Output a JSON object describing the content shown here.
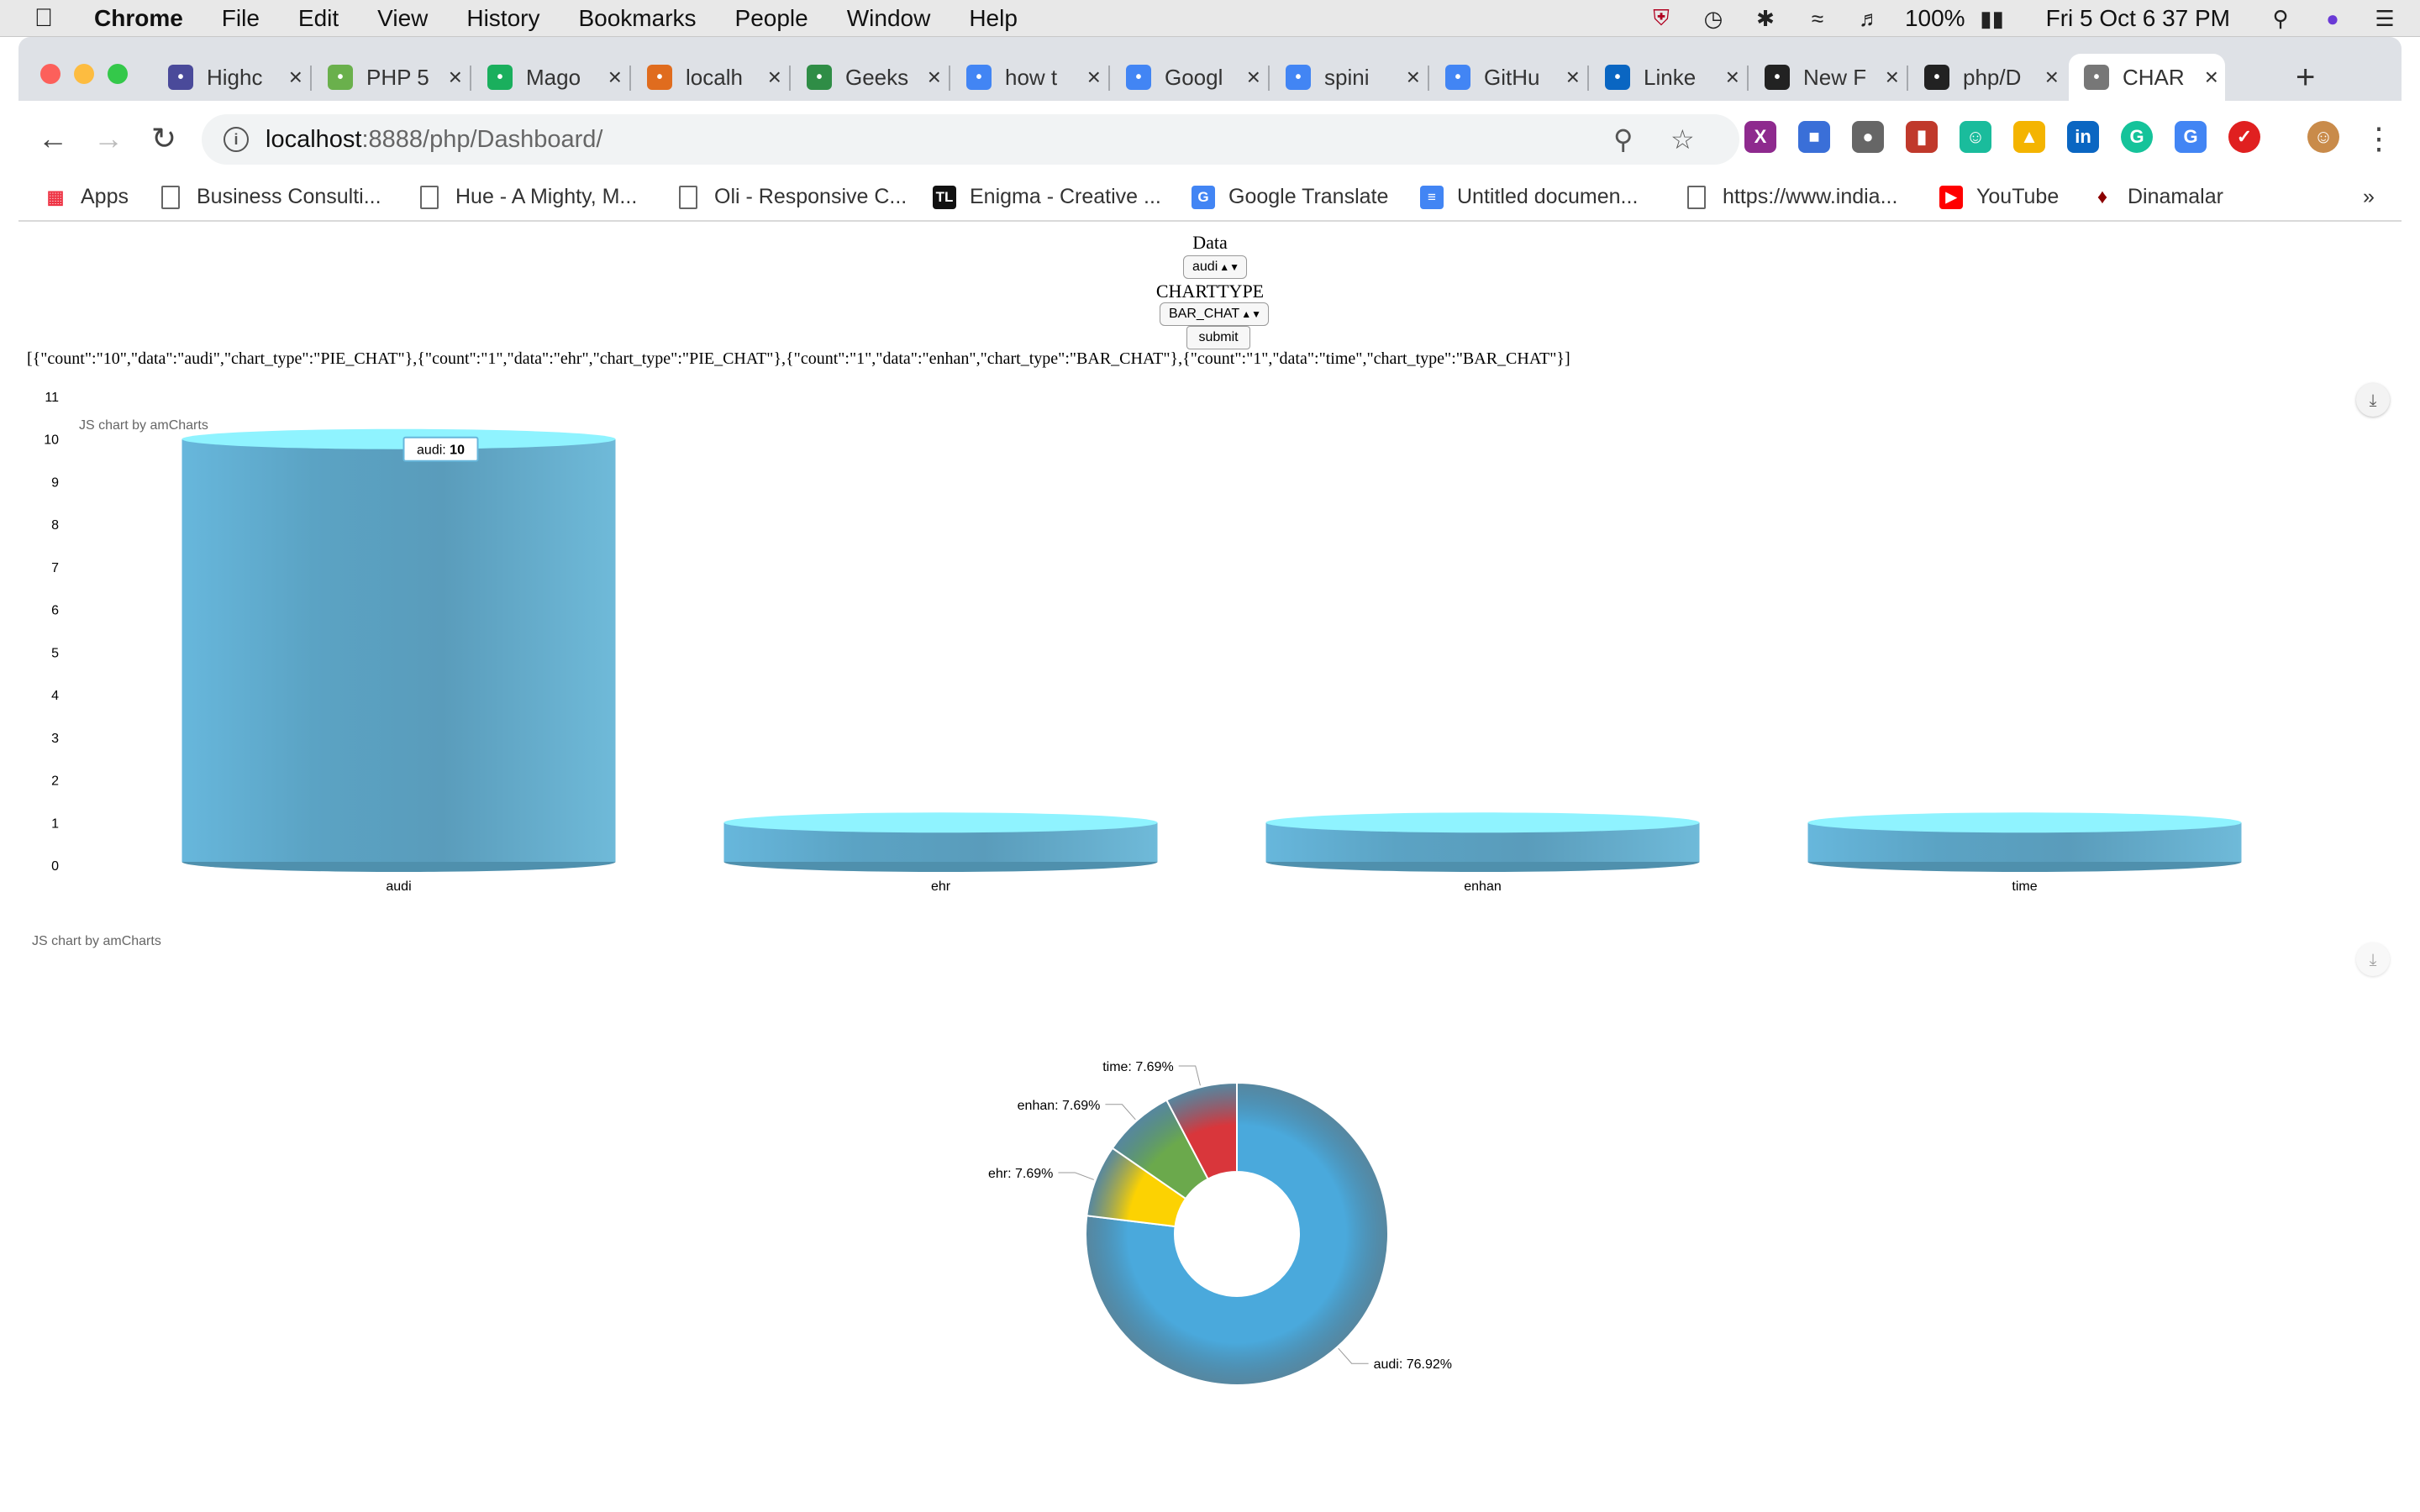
{
  "menubar": {
    "app": "Chrome",
    "items": [
      "File",
      "Edit",
      "View",
      "History",
      "Bookmarks",
      "People",
      "Window",
      "Help"
    ],
    "battery": "100%",
    "datetime": "Fri 5 Oct  6 37 PM"
  },
  "tabs": [
    {
      "title": "Highc",
      "icon": "highcharts-icon",
      "color": "#4a4a9a"
    },
    {
      "title": "PHP 5",
      "icon": "w3-icon",
      "color": "#6ab04c"
    },
    {
      "title": "Mago",
      "icon": "check-icon",
      "color": "#1aaf5d"
    },
    {
      "title": "localh",
      "icon": "phpmyadmin-icon",
      "color": "#e06c1e"
    },
    {
      "title": "Geeks",
      "icon": "geeksforgeeks-icon",
      "color": "#2f8d46"
    },
    {
      "title": "how t",
      "icon": "google-icon",
      "color": "#4285f4"
    },
    {
      "title": "Googl",
      "icon": "google-translate-icon",
      "color": "#4285f4"
    },
    {
      "title": "spini",
      "icon": "google-icon",
      "color": "#4285f4"
    },
    {
      "title": "GitHu",
      "icon": "google-docs-icon",
      "color": "#4285f4"
    },
    {
      "title": "Linke",
      "icon": "linkedin-icon",
      "color": "#0a66c2"
    },
    {
      "title": "New F",
      "icon": "github-icon",
      "color": "#222222"
    },
    {
      "title": "php/D",
      "icon": "github-icon",
      "color": "#222222"
    },
    {
      "title": "CHAR",
      "icon": "globe-icon",
      "color": "#777777",
      "active": true
    }
  ],
  "address": {
    "host": "localhost",
    "rest": ":8888/php/Dashboard/"
  },
  "bookmarks": [
    {
      "label": "Apps",
      "icon": "apps-grid-icon"
    },
    {
      "label": "Business Consulti...",
      "icon": "page-icon"
    },
    {
      "label": "Hue - A Mighty, M...",
      "icon": "page-icon"
    },
    {
      "label": "Oli - Responsive C...",
      "icon": "page-icon"
    },
    {
      "label": "Enigma - Creative ...",
      "icon": "tl-icon"
    },
    {
      "label": "Google Translate",
      "icon": "google-translate-icon"
    },
    {
      "label": "Untitled documen...",
      "icon": "google-docs-icon"
    },
    {
      "label": "https://www.india...",
      "icon": "page-icon"
    },
    {
      "label": "YouTube",
      "icon": "youtube-icon"
    },
    {
      "label": "Dinamalar",
      "icon": "dinamalar-icon"
    }
  ],
  "page": {
    "data_label": "Data",
    "data_select_value": "audi",
    "charttype_label": "CHARTTYPE",
    "charttype_select_value": "BAR_CHAT",
    "submit_label": "submit",
    "json_output": "[{\"count\":\"10\",\"data\":\"audi\",\"chart_type\":\"PIE_CHAT\"},{\"count\":\"1\",\"data\":\"ehr\",\"chart_type\":\"PIE_CHAT\"},{\"count\":\"1\",\"data\":\"enhan\",\"chart_type\":\"BAR_CHAT\"},{\"count\":\"1\",\"data\":\"time\",\"chart_type\":\"BAR_CHAT\"}]",
    "credit": "JS chart by amCharts"
  },
  "chart_data": [
    {
      "type": "bar",
      "categories": [
        "audi",
        "ehr",
        "enhan",
        "time"
      ],
      "values": [
        10,
        1,
        1,
        1
      ],
      "ylim": [
        0,
        11
      ],
      "yticks": [
        0,
        1,
        2,
        3,
        4,
        5,
        6,
        7,
        8,
        9,
        10,
        11
      ],
      "tooltip": {
        "category": "audi",
        "value": "10"
      },
      "colors": {
        "body": "#67b7dc",
        "top": "#8ff3ff"
      }
    },
    {
      "type": "pie",
      "style": "donut",
      "labels": [
        "audi",
        "ehr",
        "enhan",
        "time"
      ],
      "values": [
        10,
        1,
        1,
        1
      ],
      "percent_labels": [
        "audi: 76.92%",
        "ehr: 7.69%",
        "enhan: 7.69%",
        "time: 7.69%"
      ],
      "colors": [
        "#4aa9dc",
        "#fcd202",
        "#6ba94c",
        "#d9363b"
      ]
    }
  ]
}
